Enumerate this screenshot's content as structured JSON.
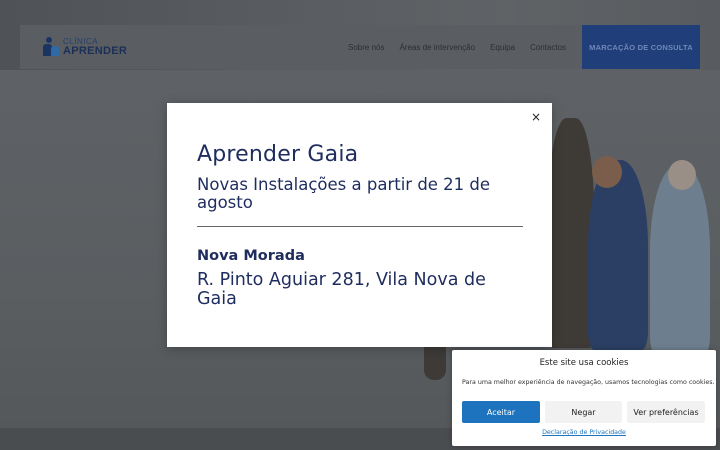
{
  "header": {
    "logo_small": "CLÍNICA",
    "logo_big": "APRENDER",
    "nav": [
      {
        "label": "Sobre nós"
      },
      {
        "label": "Áreas de intervenção"
      },
      {
        "label": "Equipa"
      },
      {
        "label": "Contactos"
      }
    ],
    "cta_label": "MARCAÇÃO DE CONSULTA",
    "cta_color": "#1f3e7a"
  },
  "modal": {
    "close_symbol": "×",
    "title": "Aprender Gaia",
    "subtitle": "Novas Instalações a partir de 21 de agosto",
    "section_label": "Nova Morada",
    "address": "R. Pinto Aguiar 281, Vila Nova de Gaia",
    "text_color": "#1e2c5e"
  },
  "cookie_banner": {
    "title": "Este site usa cookies",
    "text": "Para uma melhor experiência de navegação, usamos tecnologias como cookies.",
    "accept_label": "Aceitar",
    "deny_label": "Negar",
    "prefs_label": "Ver preferências",
    "privacy_link": "Declaração de Privacidade",
    "accent_color": "#1e73be"
  },
  "icons": {
    "logo": "clinic-logo-icon",
    "close": "close-icon"
  }
}
